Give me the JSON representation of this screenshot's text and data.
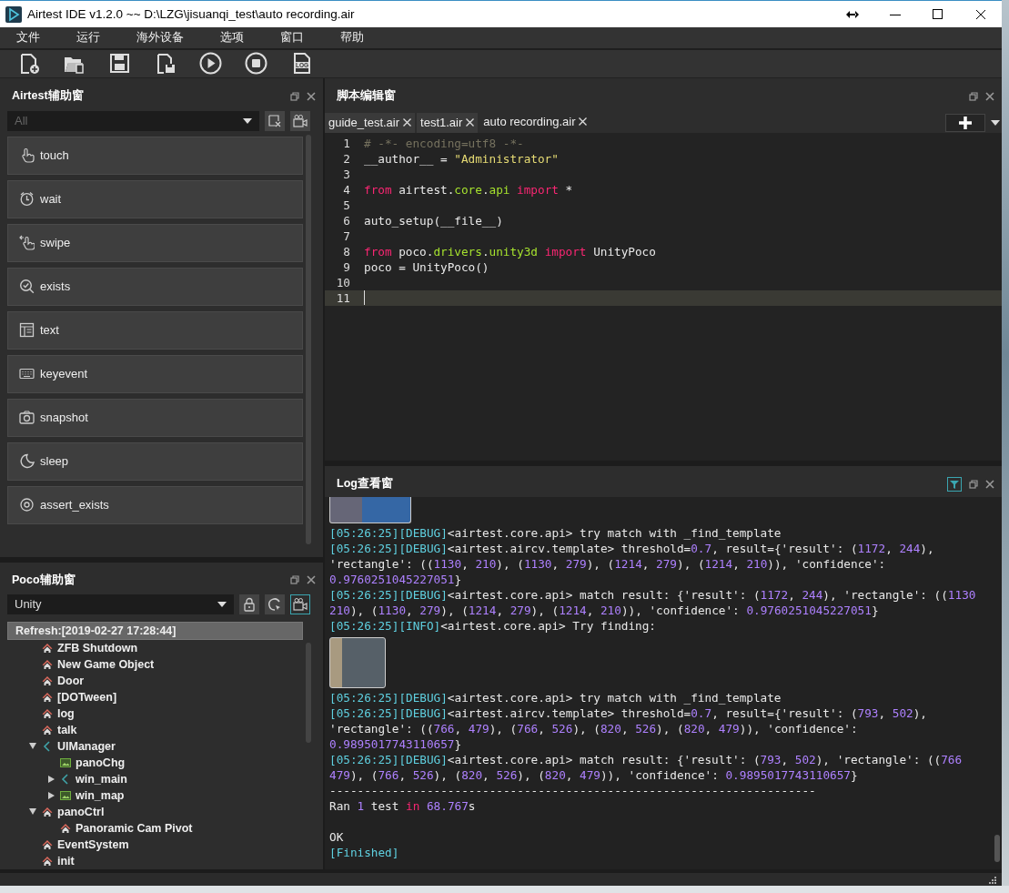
{
  "window": {
    "title": "Airtest IDE v1.2.0 ~~ D:\\LZG\\jisuanqi_test\\auto recording.air"
  },
  "menu": [
    "文件",
    "运行",
    "海外设备",
    "选项",
    "窗口",
    "帮助"
  ],
  "toolbar": [
    {
      "kind": "new-file"
    },
    {
      "kind": "open"
    },
    {
      "kind": "save"
    },
    {
      "kind": "save-as"
    },
    {
      "kind": "run"
    },
    {
      "kind": "stop"
    },
    {
      "kind": "log",
      "label": "LOG"
    }
  ],
  "airtest_panel": {
    "title": "Airtest辅助窗",
    "filter": {
      "placeholder": "All"
    },
    "actions": [
      {
        "kind": "touch",
        "label": "touch"
      },
      {
        "kind": "wait",
        "label": "wait"
      },
      {
        "kind": "swipe",
        "label": "swipe"
      },
      {
        "kind": "exists",
        "label": "exists"
      },
      {
        "kind": "text",
        "label": "text"
      },
      {
        "kind": "keyevent",
        "label": "keyevent"
      },
      {
        "kind": "snapshot",
        "label": "snapshot"
      },
      {
        "kind": "sleep",
        "label": "sleep"
      },
      {
        "kind": "assert",
        "label": "assert_exists"
      }
    ]
  },
  "poco_panel": {
    "title": "Poco辅助窗",
    "mode": "Unity",
    "tools": [
      {
        "kind": "lock",
        "on": false
      },
      {
        "kind": "inspect",
        "on": false
      },
      {
        "kind": "record",
        "on": true
      }
    ],
    "refresh": "Refresh:[2019-02-27 17:28:44]",
    "tree": [
      {
        "label": "ZFB Shutdown",
        "kind": "node"
      },
      {
        "label": "New Game Object",
        "kind": "node"
      },
      {
        "label": "Door",
        "kind": "node"
      },
      {
        "label": "[DOTween]",
        "kind": "node"
      },
      {
        "label": "log",
        "kind": "node"
      },
      {
        "label": "talk",
        "kind": "node"
      },
      {
        "label": "UIManager",
        "kind": "ui",
        "expanded": true,
        "children": [
          {
            "label": "panoChg",
            "kind": "image"
          },
          {
            "label": "win_main",
            "kind": "ui",
            "expanded": false
          },
          {
            "label": "win_map",
            "kind": "image",
            "expanded": false
          }
        ]
      },
      {
        "label": "panoCtrl",
        "kind": "node",
        "expanded": true,
        "children": [
          {
            "label": "Panoramic Cam Pivot",
            "kind": "node"
          }
        ]
      },
      {
        "label": "EventSystem",
        "kind": "node"
      },
      {
        "label": "init",
        "kind": "node"
      }
    ]
  },
  "editor": {
    "title": "脚本编辑窗",
    "tabs": [
      {
        "label": "guide_test.air",
        "selected": false
      },
      {
        "label": "test1.air",
        "selected": false
      },
      {
        "label": "auto recording.air",
        "selected": true
      }
    ],
    "lines": [
      {
        "number": "1",
        "current": false,
        "segments": [
          {
            "text": "# -*- encoding=utf8 -*-",
            "kind": "comment"
          }
        ]
      },
      {
        "number": "2",
        "current": false,
        "segments": [
          "__author__ = ",
          {
            "text": "\"Administrator\"",
            "kind": "string"
          }
        ]
      },
      {
        "number": "3",
        "current": false
      },
      {
        "number": "4",
        "current": false,
        "segments": [
          {
            "text": "from",
            "kind": "keyword"
          },
          " airtest.",
          {
            "text": "core",
            "kind": "module"
          },
          ".",
          {
            "text": "api",
            "kind": "module"
          },
          {
            "text": " import",
            "kind": "keyword"
          },
          " *"
        ]
      },
      {
        "number": "5",
        "current": false
      },
      {
        "number": "6",
        "current": false,
        "segments": [
          "auto_setup(__file__)"
        ]
      },
      {
        "number": "7",
        "current": false
      },
      {
        "number": "8",
        "current": false,
        "segments": [
          {
            "text": "from",
            "kind": "keyword"
          },
          " poco.",
          {
            "text": "drivers",
            "kind": "module"
          },
          ".",
          {
            "text": "unity3d",
            "kind": "module"
          },
          {
            "text": " import",
            "kind": "keyword"
          },
          " UnityPoco"
        ]
      },
      {
        "number": "9",
        "current": false,
        "segments": [
          "poco = UnityPoco()"
        ]
      },
      {
        "number": "10",
        "current": false
      },
      {
        "number": "11",
        "current": true
      }
    ]
  },
  "log": {
    "title": "Log查看窗",
    "lines": [
      {
        "kind": "thumbnail"
      },
      {
        "kind": "text",
        "segments": [
          {
            "text": "[05:26:25][DEBUG]",
            "kind": "tag"
          },
          "<airtest.core.api> try match with _find_template"
        ]
      },
      {
        "kind": "text",
        "segments": [
          {
            "text": "[05:26:25][DEBUG]",
            "kind": "tag"
          },
          "<airtest.aircv.template> threshold=",
          {
            "text": "0.7",
            "kind": "number"
          },
          ", result={'result': (",
          {
            "text": "1172",
            "kind": "number"
          },
          ", ",
          {
            "text": "244",
            "kind": "number"
          },
          "),"
        ]
      },
      {
        "kind": "text",
        "segments": [
          "'rectangle': ((",
          {
            "text": "1130",
            "kind": "number"
          },
          ", ",
          {
            "text": "210",
            "kind": "number"
          },
          "), (",
          {
            "text": "1130",
            "kind": "number"
          },
          ", ",
          {
            "text": "279",
            "kind": "number"
          },
          "), (",
          {
            "text": "1214",
            "kind": "number"
          },
          ", ",
          {
            "text": "279",
            "kind": "number"
          },
          "), (",
          {
            "text": "1214",
            "kind": "number"
          },
          ", ",
          {
            "text": "210",
            "kind": "number"
          },
          ")), 'confidence':"
        ]
      },
      {
        "kind": "text",
        "segments": [
          {
            "text": "0.9760251045227051",
            "kind": "number"
          },
          "}"
        ]
      },
      {
        "kind": "text",
        "segments": [
          {
            "text": "[05:26:25][DEBUG]",
            "kind": "tag"
          },
          "<airtest.core.api> match result: {'result': (",
          {
            "text": "1172",
            "kind": "number"
          },
          ", ",
          {
            "text": "244",
            "kind": "number"
          },
          "), 'rectangle': ((",
          {
            "text": "1130",
            "kind": "number"
          }
        ]
      },
      {
        "kind": "text",
        "segments": [
          {
            "text": "210",
            "kind": "number"
          },
          "), (",
          {
            "text": "1130",
            "kind": "number"
          },
          ", ",
          {
            "text": "279",
            "kind": "number"
          },
          "), (",
          {
            "text": "1214",
            "kind": "number"
          },
          ", ",
          {
            "text": "279",
            "kind": "number"
          },
          "), (",
          {
            "text": "1214",
            "kind": "number"
          },
          ", ",
          {
            "text": "210",
            "kind": "number"
          },
          ")), 'confidence': ",
          {
            "text": "0.9760251045227051",
            "kind": "number"
          },
          "}"
        ]
      },
      {
        "kind": "text",
        "segments": [
          {
            "text": "[05:26:25][INFO]",
            "kind": "tag"
          },
          "<airtest.core.api> Try finding:"
        ]
      },
      {
        "kind": "thumbnail"
      },
      {
        "kind": "text",
        "segments": [
          {
            "text": "[05:26:25][DEBUG]",
            "kind": "tag"
          },
          "<airtest.core.api> try match with _find_template"
        ]
      },
      {
        "kind": "text",
        "segments": [
          {
            "text": "[05:26:25][DEBUG]",
            "kind": "tag"
          },
          "<airtest.aircv.template> threshold=",
          {
            "text": "0.7",
            "kind": "number"
          },
          ", result={'result': (",
          {
            "text": "793",
            "kind": "number"
          },
          ", ",
          {
            "text": "502",
            "kind": "number"
          },
          "),"
        ]
      },
      {
        "kind": "text",
        "segments": [
          "'rectangle': ((",
          {
            "text": "766",
            "kind": "number"
          },
          ", ",
          {
            "text": "479",
            "kind": "number"
          },
          "), (",
          {
            "text": "766",
            "kind": "number"
          },
          ", ",
          {
            "text": "526",
            "kind": "number"
          },
          "), (",
          {
            "text": "820",
            "kind": "number"
          },
          ", ",
          {
            "text": "526",
            "kind": "number"
          },
          "), (",
          {
            "text": "820",
            "kind": "number"
          },
          ", ",
          {
            "text": "479",
            "kind": "number"
          },
          ")), 'confidence':"
        ]
      },
      {
        "kind": "text",
        "segments": [
          {
            "text": "0.9895017743110657",
            "kind": "number"
          },
          "}"
        ]
      },
      {
        "kind": "text",
        "segments": [
          {
            "text": "[05:26:25][DEBUG]",
            "kind": "tag"
          },
          "<airtest.core.api> match result: {'result': (",
          {
            "text": "793",
            "kind": "number"
          },
          ", ",
          {
            "text": "502",
            "kind": "number"
          },
          "), 'rectangle': ((",
          {
            "text": "766",
            "kind": "number"
          }
        ]
      },
      {
        "kind": "text",
        "segments": [
          {
            "text": "479",
            "kind": "number"
          },
          "), (",
          {
            "text": "766",
            "kind": "number"
          },
          ", ",
          {
            "text": "526",
            "kind": "number"
          },
          "), (",
          {
            "text": "820",
            "kind": "number"
          },
          ", ",
          {
            "text": "526",
            "kind": "number"
          },
          "), (",
          {
            "text": "820",
            "kind": "number"
          },
          ", ",
          {
            "text": "479",
            "kind": "number"
          },
          ")), 'confidence': ",
          {
            "text": "0.9895017743110657",
            "kind": "number"
          },
          "}"
        ]
      },
      {
        "kind": "text",
        "segments": [
          "----------------------------------------------------------------------"
        ]
      },
      {
        "kind": "text",
        "segments": [
          "Ran ",
          {
            "text": "1",
            "kind": "number"
          },
          " test ",
          {
            "text": "in ",
            "kind": "keyword"
          },
          {
            "text": "68.767",
            "kind": "number"
          },
          "s"
        ]
      },
      {
        "kind": "blank"
      },
      {
        "kind": "text",
        "segments": [
          "OK"
        ]
      },
      {
        "kind": "text",
        "segments": [
          {
            "text": "[Finished]",
            "kind": "tag"
          }
        ]
      }
    ]
  }
}
